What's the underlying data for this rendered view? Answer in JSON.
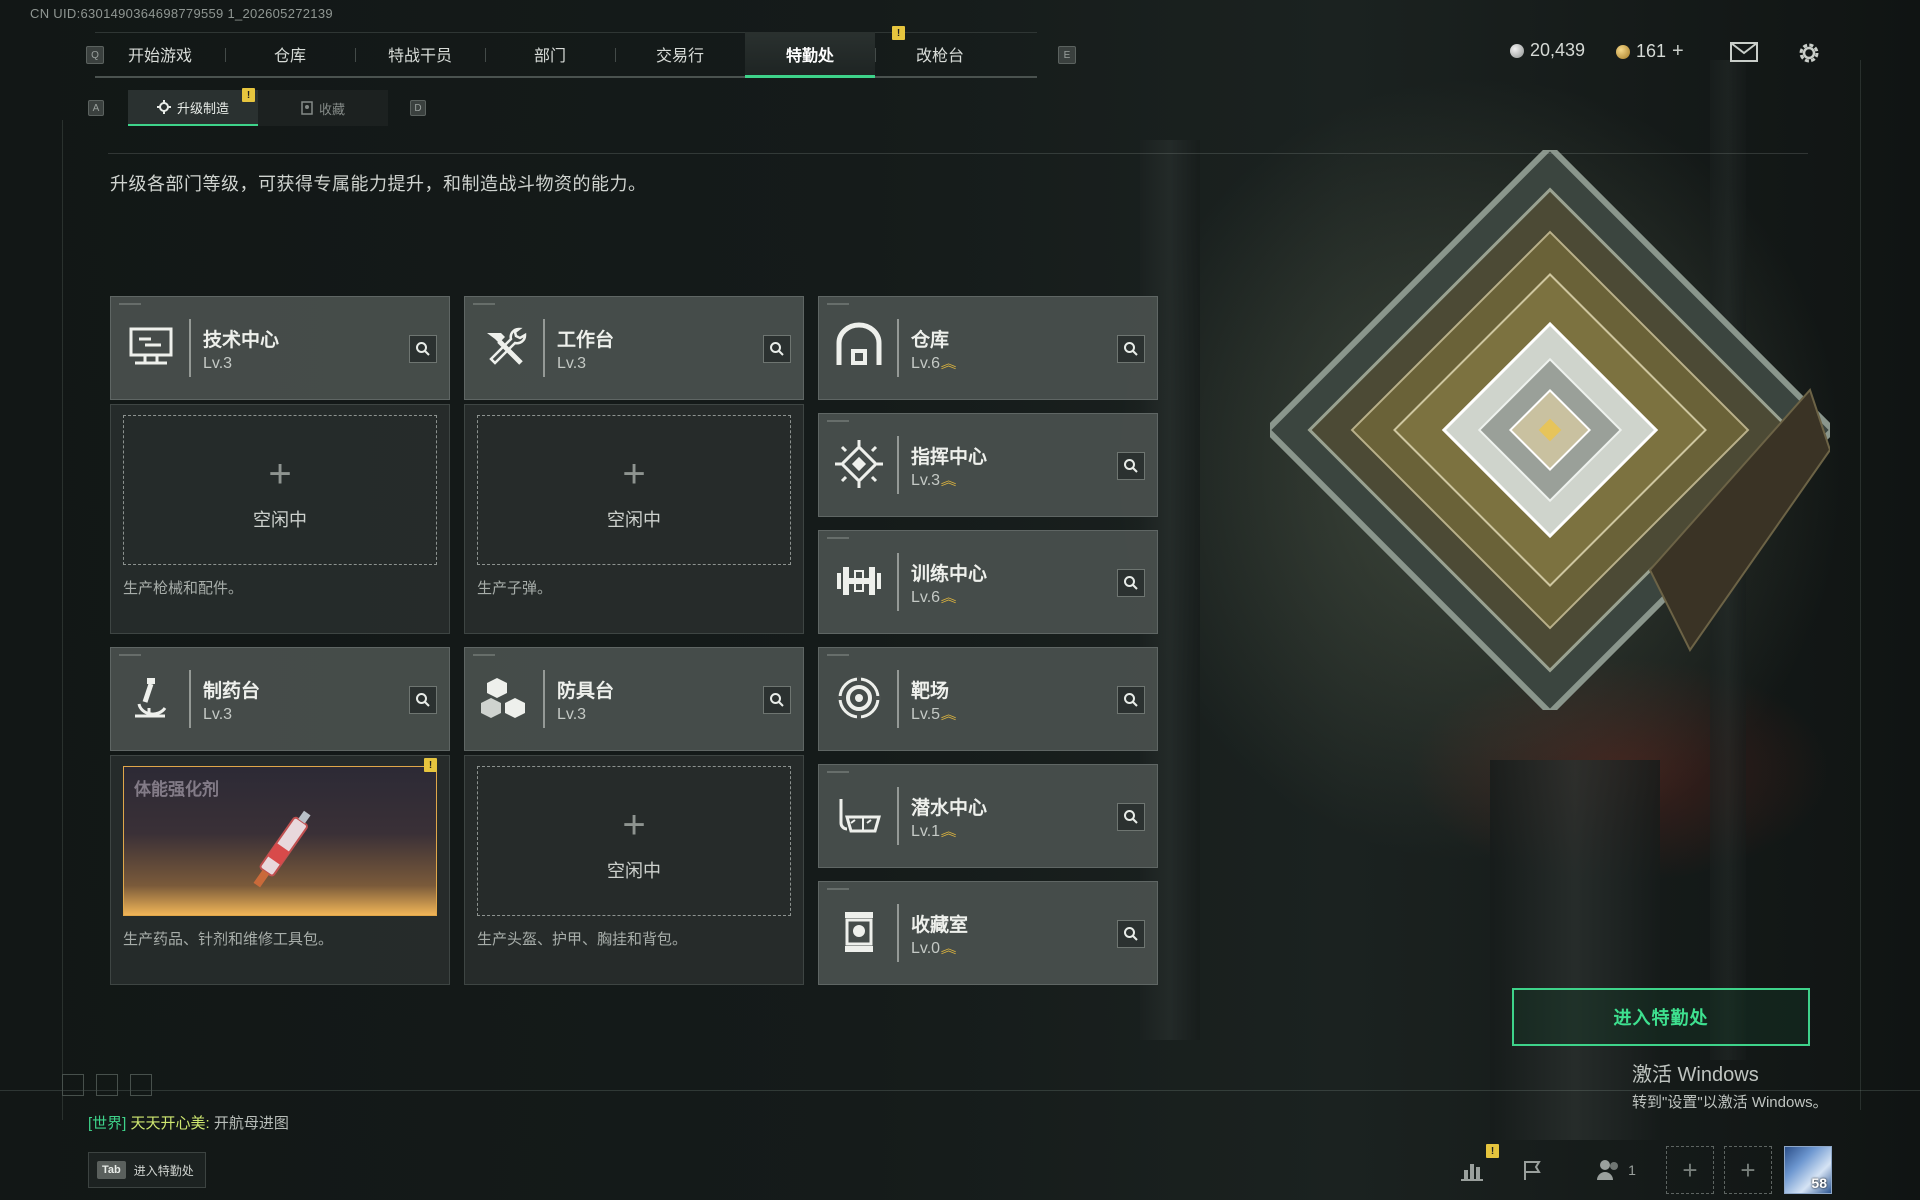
{
  "uid": "CN UID:6301490364698779559 1_202605272139",
  "nav": {
    "key_left": "Q",
    "key_right": "E",
    "tabs": [
      "开始游戏",
      "仓库",
      "特战干员",
      "部门",
      "交易行",
      "特勤处",
      "改枪台"
    ],
    "active": "特勤处",
    "badge": "!"
  },
  "currency": {
    "silver": "20,439",
    "gold": "161",
    "plus": "+"
  },
  "subnav": {
    "key_left": "A",
    "key_right": "D",
    "tabs": [
      "升级制造",
      "收藏"
    ],
    "badge": "!"
  },
  "description": "升级各部门等级，可获得专属能力提升，和制造战斗物资的能力。",
  "stations": [
    {
      "name": "技术中心",
      "level": "Lv.3",
      "icon": "monitor-icon",
      "status": "空闲中",
      "desc": "生产枪械和配件。"
    },
    {
      "name": "工作台",
      "level": "Lv.3",
      "icon": "hammer-wrench-icon",
      "status": "空闲中",
      "desc": "生产子弹。"
    },
    {
      "name": "制药台",
      "level": "Lv.3",
      "icon": "microscope-icon",
      "crafting": "体能强化剂",
      "desc": "生产药品、针剂和维修工具包。"
    },
    {
      "name": "防具台",
      "level": "Lv.3",
      "icon": "cubes-icon",
      "status": "空闲中",
      "desc": "生产头盔、护甲、胸挂和背包。"
    }
  ],
  "departments": [
    {
      "name": "仓库",
      "level": "Lv.6",
      "icon": "warehouse-icon"
    },
    {
      "name": "指挥中心",
      "level": "Lv.3",
      "icon": "command-chip-icon"
    },
    {
      "name": "训练中心",
      "level": "Lv.6",
      "icon": "dumbbell-icon"
    },
    {
      "name": "靶场",
      "level": "Lv.5",
      "icon": "target-icon"
    },
    {
      "name": "潜水中心",
      "level": "Lv.1",
      "icon": "diving-mask-icon"
    },
    {
      "name": "收藏室",
      "level": "Lv.0",
      "icon": "display-case-icon"
    }
  ],
  "enter_button": "进入特勤处",
  "windows_activation": {
    "title": "激活 Windows",
    "subtitle": "转到\"设置\"以激活 Windows。"
  },
  "chat": {
    "channel": "[世界]",
    "user": "天天开心美:",
    "message": "开航母进图"
  },
  "tab_hint": {
    "key": "Tab",
    "label": "进入特勤处"
  },
  "bottom_bar": {
    "friends_count": "1",
    "avatar_level": "58"
  },
  "colors": {
    "accent": "#3ed38a",
    "warning": "#e6c53e",
    "upgrade": "#e3b93f"
  }
}
